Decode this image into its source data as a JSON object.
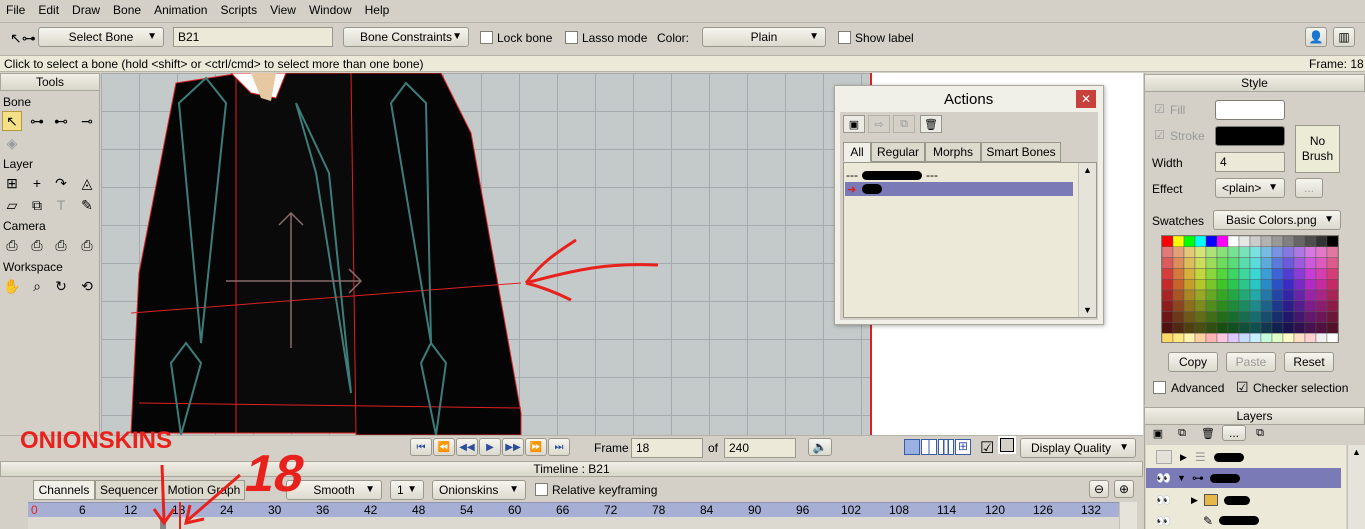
{
  "menu": [
    "File",
    "Edit",
    "Draw",
    "Bone",
    "Animation",
    "Scripts",
    "View",
    "Window",
    "Help"
  ],
  "toolbar": {
    "tool_mode": "Select Bone",
    "bone_name": "B21",
    "constraints": "Bone Constraints",
    "lock_bone": "Lock bone",
    "lasso_mode": "Lasso mode",
    "color_label": "Color:",
    "color_value": "Plain",
    "show_label": "Show label"
  },
  "status": {
    "hint": "Click to select a bone (hold <shift> or <ctrl/cmd> to select more than one bone)",
    "frame": "Frame: 18"
  },
  "tools": {
    "title": "Tools",
    "sections": [
      "Bone",
      "Layer",
      "Camera",
      "Workspace"
    ]
  },
  "actions": {
    "title": "Actions",
    "tabs": [
      "All",
      "Regular",
      "Morphs",
      "Smart Bones"
    ],
    "row1": "---",
    "row1_suffix": "---"
  },
  "style": {
    "title": "Style",
    "fill": "Fill",
    "stroke": "Stroke",
    "no_brush": "No Brush",
    "width_label": "Width",
    "width_value": "4",
    "effect_label": "Effect",
    "effect_value": "<plain>",
    "effect_more": "...",
    "swatches_label": "Swatches",
    "swatches_value": "Basic Colors.png",
    "copy": "Copy",
    "paste": "Paste",
    "reset": "Reset",
    "advanced": "Advanced",
    "checker": "Checker selection",
    "fill_color": "#ffffff",
    "stroke_color": "#000000"
  },
  "layers": {
    "title": "Layers",
    "more": "..."
  },
  "playback": {
    "frame_label": "Frame",
    "frame_value": "18",
    "of_label": "of",
    "total": "240",
    "display_quality": "Display Quality"
  },
  "timeline": {
    "title": "Timeline : B21",
    "tabs": [
      "Channels",
      "Sequencer",
      "Motion Graph"
    ],
    "interp": "Smooth",
    "interp_step": "1",
    "onionskins": "Onionskins",
    "relative": "Relative keyframing",
    "ticks": [
      "0",
      "6",
      "12",
      "18",
      "24",
      "30",
      "36",
      "42",
      "48",
      "54",
      "60",
      "66",
      "72",
      "78",
      "84",
      "90",
      "96",
      "102",
      "108",
      "114",
      "120",
      "126",
      "132"
    ]
  },
  "annotations": {
    "onionskins_text": "ONIONSKINS",
    "number_text": "18",
    "color": "#e8211c"
  }
}
